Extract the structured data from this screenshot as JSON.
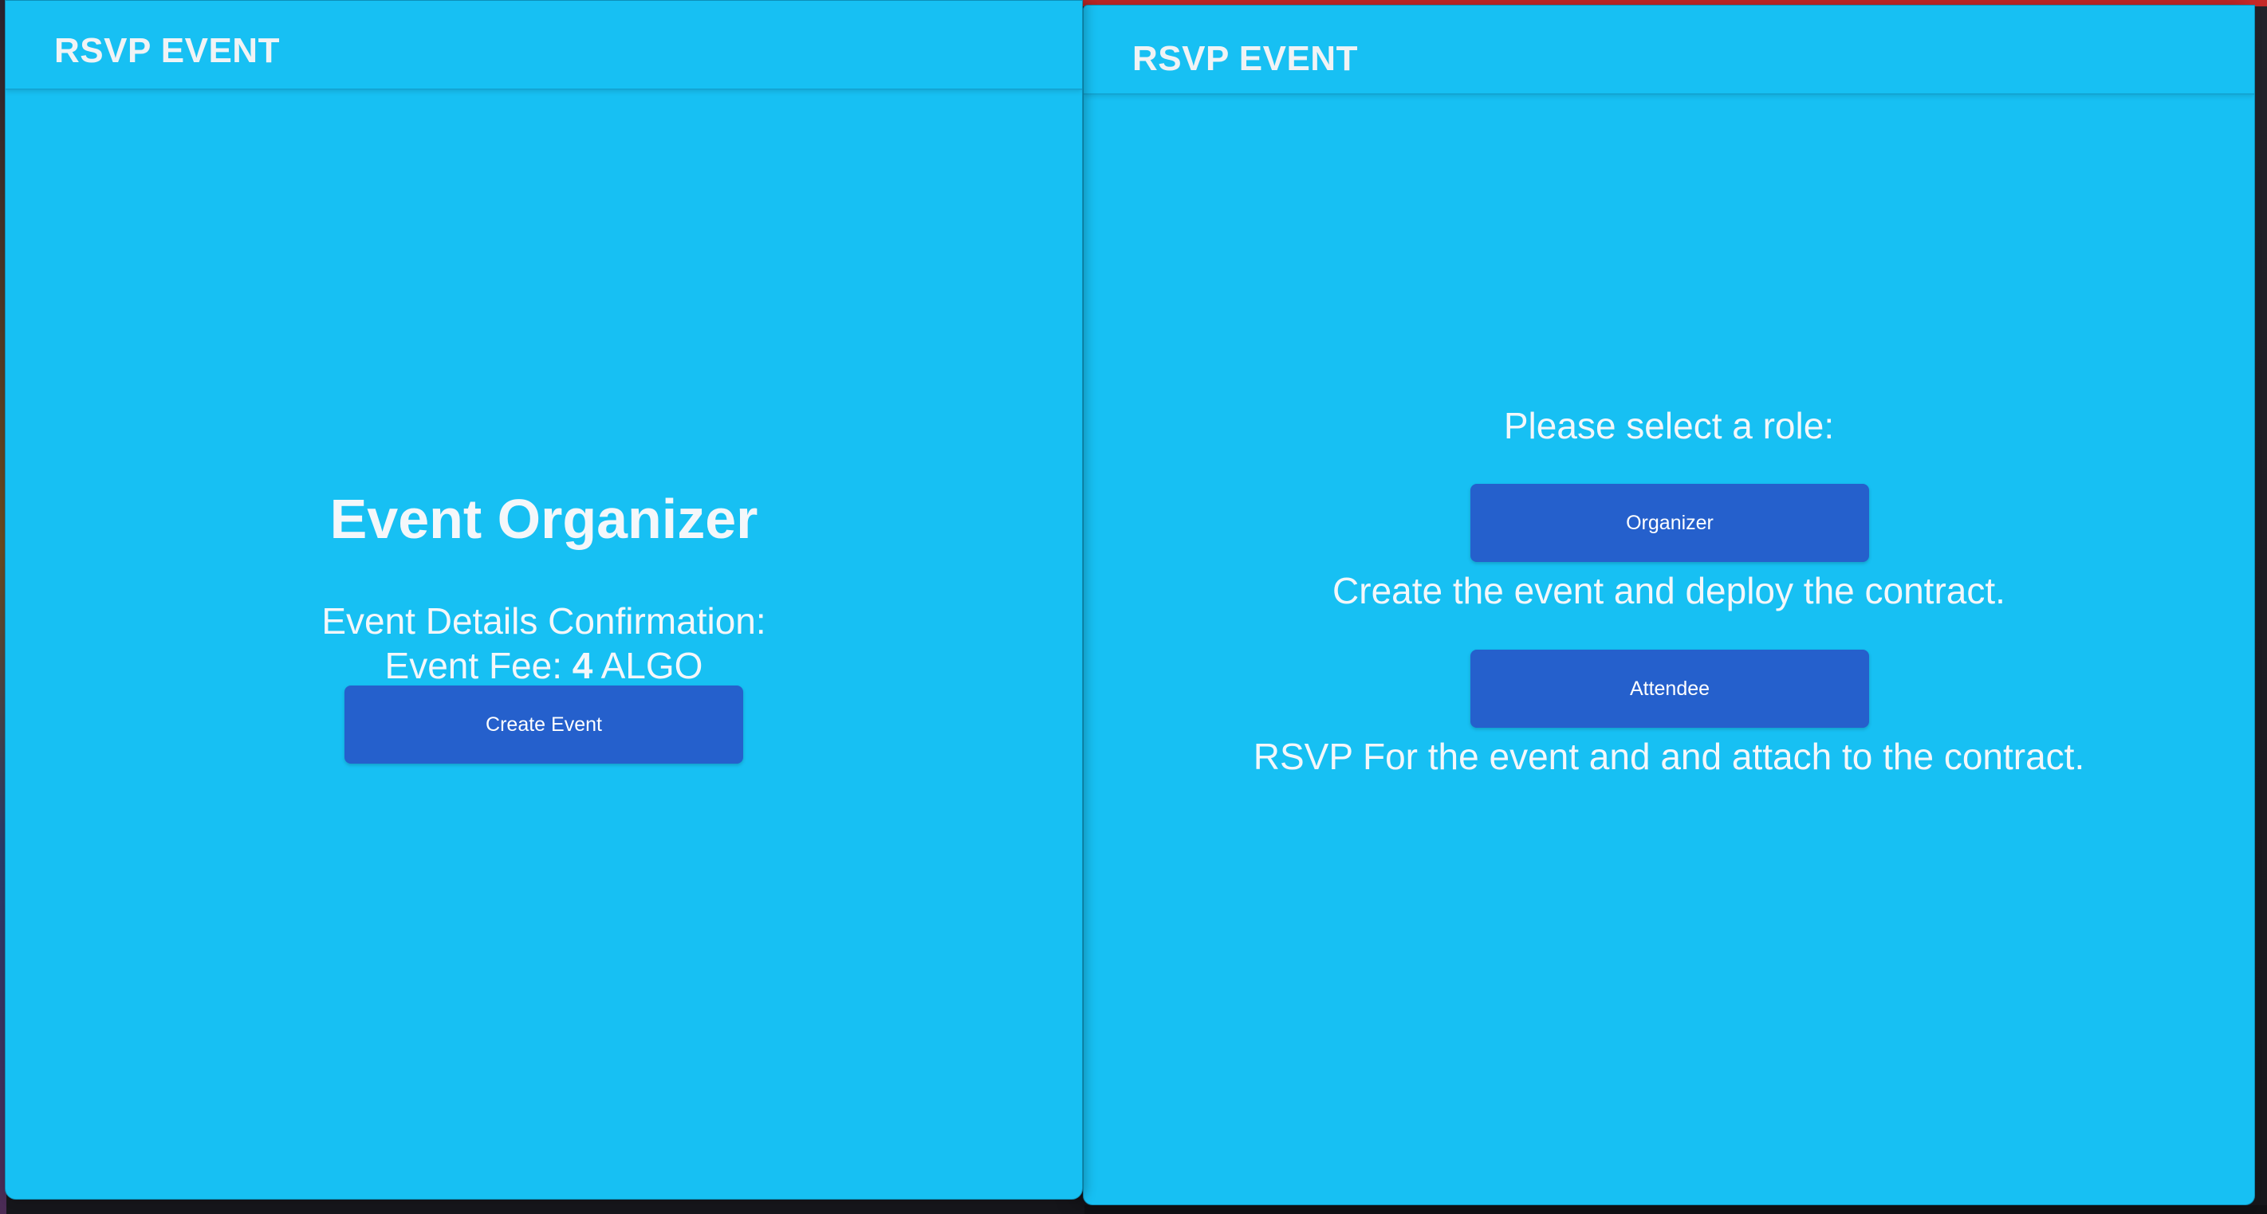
{
  "left_window": {
    "brand": "RSVP EVENT",
    "title": "Event Organizer",
    "details_heading": "Event Details Confirmation:",
    "fee_prefix": "Event Fee: ",
    "fee_value": "4",
    "fee_suffix": " ALGO",
    "create_button": "Create Event"
  },
  "right_window": {
    "brand": "RSVP EVENT",
    "prompt": "Please select a role:",
    "organizer_button": "Organizer",
    "organizer_desc": "Create the event and deploy the contract.",
    "attendee_button": "Attendee",
    "attendee_desc": "RSVP For the event and and attach to the contract."
  },
  "colors": {
    "app_background": "#17c0f3",
    "button": "#2560cc",
    "text": "#f4f7fa"
  }
}
